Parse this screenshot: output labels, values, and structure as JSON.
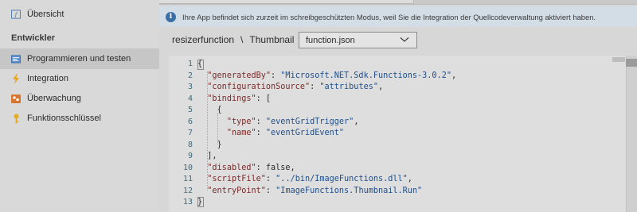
{
  "sidebar": {
    "top_item": {
      "label": "Übersicht",
      "icon": "function-icon"
    },
    "section_title": "Entwickler",
    "items": [
      {
        "label": "Programmieren und testen",
        "icon": "code-icon",
        "active": true
      },
      {
        "label": "Integration",
        "icon": "lightning-icon",
        "active": false
      },
      {
        "label": "Überwachung",
        "icon": "monitor-icon",
        "active": false
      },
      {
        "label": "Funktionsschlüssel",
        "icon": "key-icon",
        "active": false
      }
    ]
  },
  "banner": {
    "icon": "info-icon",
    "message": "Ihre App befindet sich zurzeit im schreibgeschützten Modus, weil Sie die Integration der Quellcodeverwaltung aktiviert haben."
  },
  "breadcrumb": {
    "items": [
      "resizerfunction",
      "Thumbnail"
    ],
    "separator": "\\"
  },
  "file_select": {
    "value": "function.json"
  },
  "editor": {
    "line_numbers": [
      "1",
      "2",
      "3",
      "4",
      "5",
      "6",
      "7",
      "8",
      "9",
      "10",
      "11",
      "12",
      "13"
    ],
    "lines": [
      [
        {
          "t": "{",
          "c": "plain"
        }
      ],
      [
        {
          "t": "  ",
          "c": "plain"
        },
        {
          "t": "\"generatedBy\"",
          "c": "key"
        },
        {
          "t": ": ",
          "c": "plain"
        },
        {
          "t": "\"Microsoft.NET.Sdk.Functions-3.0.2\"",
          "c": "str"
        },
        {
          "t": ",",
          "c": "plain"
        }
      ],
      [
        {
          "t": "  ",
          "c": "plain"
        },
        {
          "t": "\"configurationSource\"",
          "c": "key"
        },
        {
          "t": ": ",
          "c": "plain"
        },
        {
          "t": "\"attributes\"",
          "c": "str"
        },
        {
          "t": ",",
          "c": "plain"
        }
      ],
      [
        {
          "t": "  ",
          "c": "plain"
        },
        {
          "t": "\"bindings\"",
          "c": "key"
        },
        {
          "t": ": [",
          "c": "plain"
        }
      ],
      [
        {
          "t": "    {",
          "c": "plain"
        }
      ],
      [
        {
          "t": "      ",
          "c": "plain"
        },
        {
          "t": "\"type\"",
          "c": "key"
        },
        {
          "t": ": ",
          "c": "plain"
        },
        {
          "t": "\"eventGridTrigger\"",
          "c": "str"
        },
        {
          "t": ",",
          "c": "plain"
        }
      ],
      [
        {
          "t": "      ",
          "c": "plain"
        },
        {
          "t": "\"name\"",
          "c": "key"
        },
        {
          "t": ": ",
          "c": "plain"
        },
        {
          "t": "\"eventGridEvent\"",
          "c": "str"
        }
      ],
      [
        {
          "t": "    }",
          "c": "plain"
        }
      ],
      [
        {
          "t": "  ],",
          "c": "plain"
        }
      ],
      [
        {
          "t": "  ",
          "c": "plain"
        },
        {
          "t": "\"disabled\"",
          "c": "key"
        },
        {
          "t": ": false,",
          "c": "plain"
        }
      ],
      [
        {
          "t": "  ",
          "c": "plain"
        },
        {
          "t": "\"scriptFile\"",
          "c": "key"
        },
        {
          "t": ": ",
          "c": "plain"
        },
        {
          "t": "\"../bin/ImageFunctions.dll\"",
          "c": "str"
        },
        {
          "t": ",",
          "c": "plain"
        }
      ],
      [
        {
          "t": "  ",
          "c": "plain"
        },
        {
          "t": "\"entryPoint\"",
          "c": "key"
        },
        {
          "t": ": ",
          "c": "plain"
        },
        {
          "t": "\"ImageFunctions.Thumbnail.Run\"",
          "c": "str"
        }
      ],
      [
        {
          "t": "}",
          "c": "plain"
        }
      ]
    ]
  }
}
